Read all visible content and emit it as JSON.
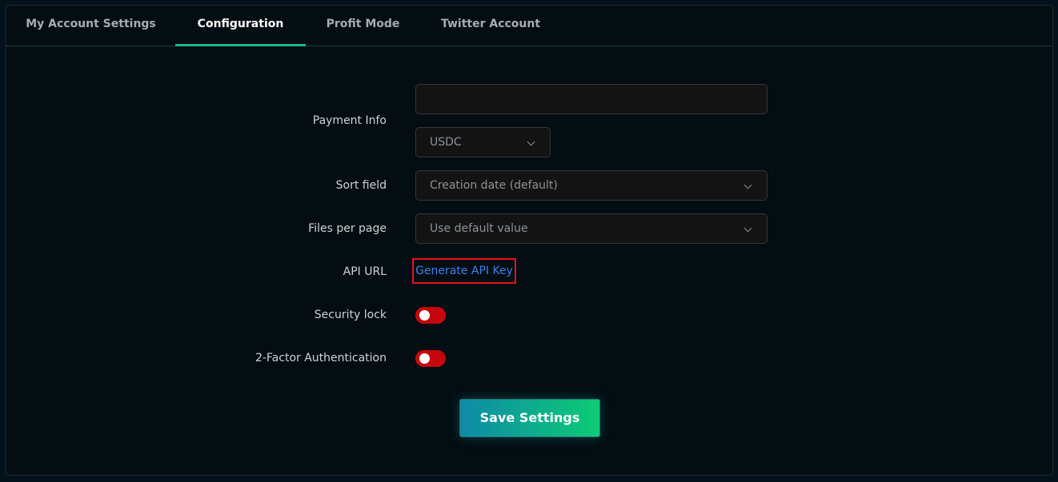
{
  "tabs": [
    {
      "label": "My Account Settings",
      "active": false
    },
    {
      "label": "Configuration",
      "active": true
    },
    {
      "label": "Profit Mode",
      "active": false
    },
    {
      "label": "Twitter Account",
      "active": false
    }
  ],
  "form": {
    "payment_info": {
      "label": "Payment Info",
      "value": "",
      "currency": "USDC"
    },
    "sort_field": {
      "label": "Sort field",
      "value": "Creation date (default)"
    },
    "files_per_page": {
      "label": "Files per page",
      "value": "Use default value"
    },
    "api_url": {
      "label": "API URL",
      "link_text": "Generate API Key"
    },
    "security_lock": {
      "label": "Security lock",
      "enabled": false
    },
    "two_factor": {
      "label": "2-Factor Authentication",
      "enabled": false
    }
  },
  "save_button": {
    "label": "Save Settings"
  },
  "colors": {
    "accent": "#15b98a",
    "toggle_off": "#c5070d",
    "link": "#3a7ff0",
    "highlight_border": "#e3141a"
  }
}
